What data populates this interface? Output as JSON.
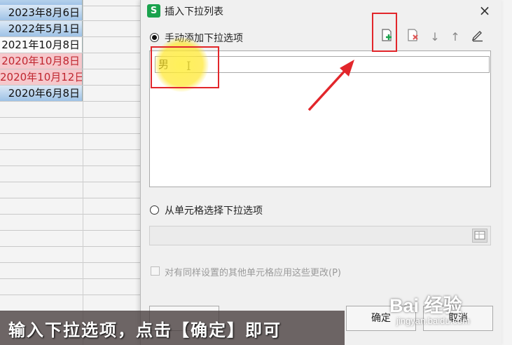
{
  "sheet": {
    "rows": [
      {
        "text": "2023年8月6日",
        "style": "blue"
      },
      {
        "text": "2022年5月1日",
        "style": "blue"
      },
      {
        "text": "2021年10月8日",
        "style": "white"
      },
      {
        "text": "2020年10月8日",
        "style": "pink"
      },
      {
        "text": "2020年10月12日",
        "style": "pink"
      },
      {
        "text": "2020年6月8日",
        "style": "blue"
      }
    ]
  },
  "dialog": {
    "app_icon": "S",
    "title": "插入下拉列表",
    "close_icon": "×",
    "manual_option_label": "手动添加下拉选项",
    "toolbar": {
      "add_icon": "add-item-icon",
      "delete_icon": "delete-item-icon",
      "down_glyph": "↓",
      "up_glyph": "↑",
      "edit_icon": "edit-icon"
    },
    "items": [
      "男"
    ],
    "cell_option_label": "从单元格选择下拉选项",
    "range_value": "",
    "apply_all_label": "对有同样设置的其他单元格应用这些更改(P)",
    "ok_label": "确定",
    "cancel_label": "取消"
  },
  "caption": "输入下拉选项，点击【确定】即可",
  "watermark": {
    "main": "Bai 经验",
    "sub": "jingyan.baidu.com"
  },
  "colors": {
    "highlight": "#e2262b",
    "add_green": "#1aa24d"
  }
}
